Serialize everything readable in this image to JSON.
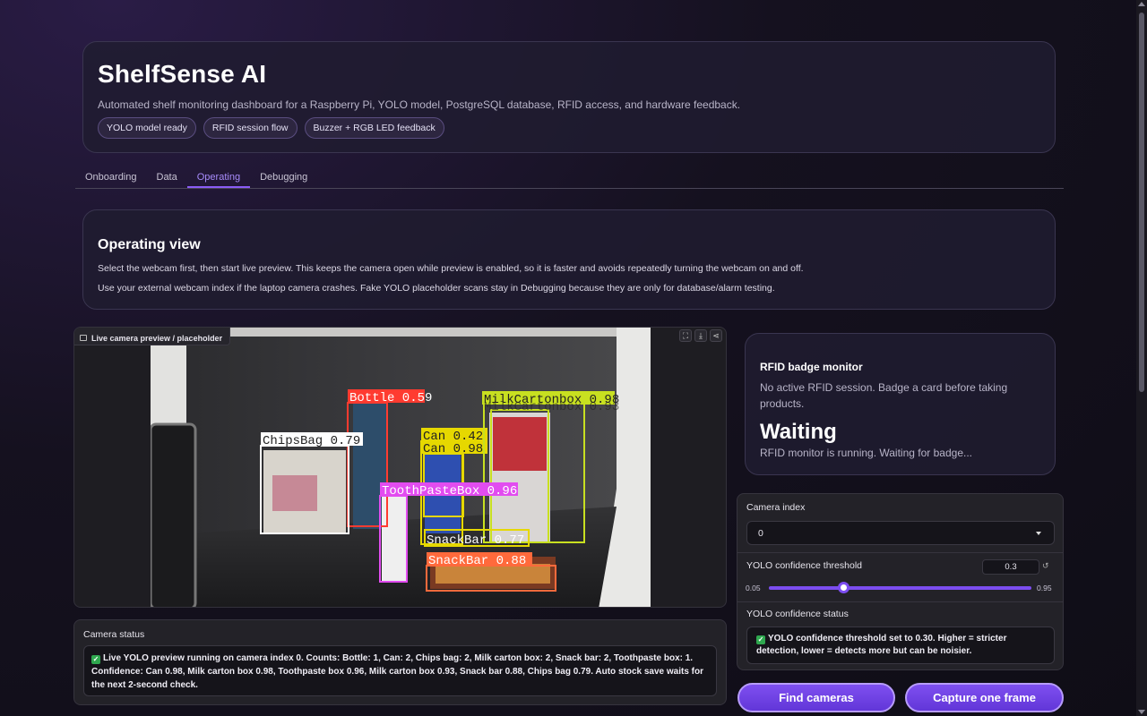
{
  "header": {
    "title": "ShelfSense AI",
    "subtitle": "Automated shelf monitoring dashboard for a Raspberry Pi, YOLO model, PostgreSQL database, RFID access, and hardware feedback.",
    "badges": [
      "YOLO model ready",
      "RFID session flow",
      "Buzzer + RGB LED feedback"
    ]
  },
  "tabs": [
    {
      "label": "Onboarding",
      "active": false
    },
    {
      "label": "Data",
      "active": false
    },
    {
      "label": "Operating",
      "active": true
    },
    {
      "label": "Debugging",
      "active": false
    }
  ],
  "operating": {
    "title": "Operating view",
    "para1": "Select the webcam first, then start live preview. This keeps the camera open while preview is enabled, so it is faster and avoids repeatedly turning the webcam on and off.",
    "para2": "Use your external webcam index if the laptop camera crashes. Fake YOLO placeholder scans stay in Debugging because they are only for database/alarm testing."
  },
  "camera": {
    "label": "Live camera preview / placeholder",
    "tool_icons": [
      "fullscreen-icon",
      "download-icon",
      "share-icon"
    ],
    "detections": [
      {
        "label": "Bottle 0.59",
        "color": "#ff3b30"
      },
      {
        "label": "ChipsBag 0.79",
        "color": "#ffffff"
      },
      {
        "label": "Can 0.42",
        "color": "#e6d800"
      },
      {
        "label": "Can 0.98",
        "color": "#e6d800"
      },
      {
        "label": "MilkCartonbox 0.98",
        "color": "#c8e020"
      },
      {
        "label": "MilkCartonbox 0.93",
        "color": "#c8e020"
      },
      {
        "label": "ToothPasteBox 0.96",
        "color": "#e24cf0"
      },
      {
        "label": "SnackBar 0.77",
        "color": "#e6d800"
      },
      {
        "label": "SnackBar 0.88",
        "color": "#ff6a3c"
      }
    ]
  },
  "rfid": {
    "title": "RFID badge monitor",
    "description": "No active RFID session. Badge a card before taking products.",
    "state": "Waiting",
    "message": "RFID monitor is running. Waiting for badge..."
  },
  "controls": {
    "camera_index_label": "Camera index",
    "camera_index_value": "0",
    "threshold_label": "YOLO confidence threshold",
    "threshold_value": "0.3",
    "threshold_fraction": 0.28,
    "slider_min": "0.05",
    "slider_max": "0.95",
    "status_label": "YOLO confidence status",
    "status_text": "YOLO confidence threshold set to 0.30. Higher = stricter detection, lower = detects more but can be noisier."
  },
  "camera_status": {
    "label": "Camera status",
    "text": "Live YOLO preview running on camera index 0. Counts: Bottle: 1, Can: 2, Chips bag: 2, Milk carton box: 2, Snack bar: 2, Toothpaste box: 1. Confidence: Can 0.98, Milk carton box 0.98, Toothpaste box 0.96, Milk carton box 0.93, Snack bar 0.88, Chips bag 0.79. Auto stock save waits for the next 2-second check."
  },
  "buttons": {
    "find": "Find cameras",
    "capture": "Capture one frame"
  }
}
